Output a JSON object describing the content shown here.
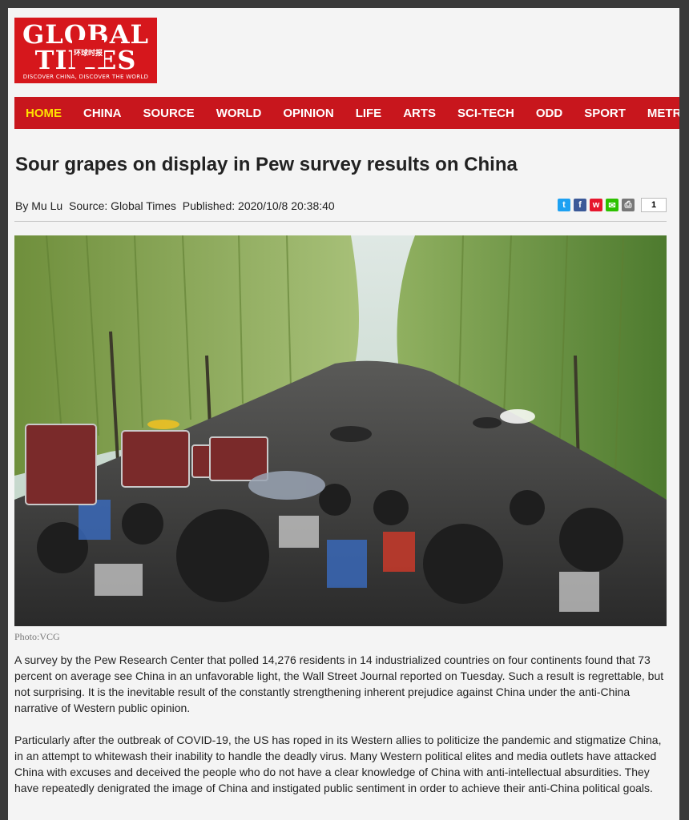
{
  "brand": {
    "line1": "GLOBAL",
    "line2": "TIMES",
    "chinese": "环球时报",
    "tagline": "DISCOVER CHINA, DISCOVER THE WORLD",
    "color": "#d6171c"
  },
  "nav": {
    "items": [
      {
        "label": "HOME",
        "active": true
      },
      {
        "label": "CHINA"
      },
      {
        "label": "SOURCE"
      },
      {
        "label": "WORLD"
      },
      {
        "label": "OPINION"
      },
      {
        "label": "LIFE"
      },
      {
        "label": "ARTS"
      },
      {
        "label": "SCI-TECH"
      },
      {
        "label": "ODD"
      },
      {
        "label": "SPORT"
      },
      {
        "label": "METRO"
      }
    ],
    "active_color": "#ffe000",
    "bg_color": "#c8161d"
  },
  "article": {
    "title": "Sour grapes on display in Pew survey results on China",
    "byline": {
      "author": "By Mu Lu",
      "source": "Source: Global Times",
      "published": "Published: 2020/10/8 20:38:40"
    },
    "share": {
      "icons": [
        {
          "name": "twitter-icon",
          "glyph": "t",
          "color": "#1da1f2"
        },
        {
          "name": "facebook-icon",
          "glyph": "f",
          "color": "#3b5998"
        },
        {
          "name": "weibo-icon",
          "glyph": "w",
          "color": "#e6162d"
        },
        {
          "name": "wechat-icon",
          "glyph": "✉",
          "color": "#2dc100"
        },
        {
          "name": "print-icon",
          "glyph": "⎙",
          "color": "#777777"
        }
      ],
      "count": "1"
    },
    "photo_caption": "Photo:VCG",
    "paragraphs": [
      "A survey by the Pew Research Center that polled 14,276 residents in 14 industrialized countries on four continents found that 73 percent on average see China in an unfavorable light, the Wall Street Journal reported on Tuesday. Such a result is regrettable, but not surprising. It is the inevitable result of the constantly strengthening inherent prejudice against China under the anti-China narrative of Western public opinion.",
      "Particularly after the outbreak of COVID-19, the US has roped in its Western allies to politicize the pandemic and stigmatize China, in an attempt to whitewash their inability to handle the deadly virus. Many Western political elites and media outlets have attacked China with excuses and deceived the people who do not have a clear knowledge of China with anti-intellectual absurdities. They have repeatedly denigrated the image of China and instigated public sentiment in order to achieve their anti-China political goals."
    ]
  }
}
